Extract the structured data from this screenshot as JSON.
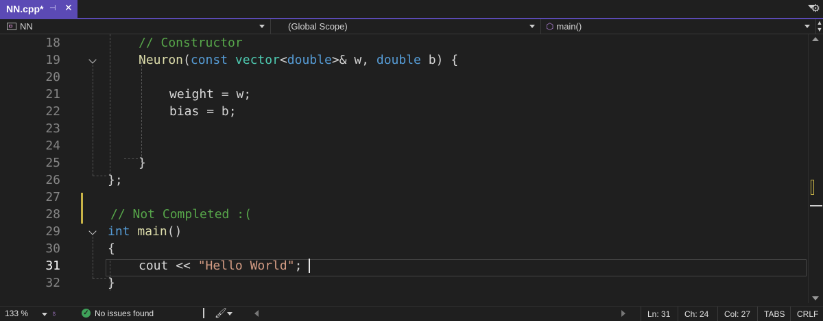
{
  "tab": {
    "title": "NN.cpp*",
    "pin_glyph": "⊣",
    "close_glyph": "✕"
  },
  "navbar": {
    "project": "NN",
    "scope": "(Global Scope)",
    "member": "main()"
  },
  "editor": {
    "current_line": 31,
    "lines": [
      {
        "number": "18"
      },
      {
        "number": "19"
      },
      {
        "number": "20"
      },
      {
        "number": "21"
      },
      {
        "number": "22"
      },
      {
        "number": "23"
      },
      {
        "number": "24"
      },
      {
        "number": "25"
      },
      {
        "number": "26"
      },
      {
        "number": "27"
      },
      {
        "number": "28"
      },
      {
        "number": "29"
      },
      {
        "number": "30"
      },
      {
        "number": "31"
      },
      {
        "number": "32"
      }
    ],
    "code": {
      "l18_comment": "// Constructor",
      "l19_fn": "Neuron",
      "l19_p1": "(",
      "l19_const": "const",
      "l19_vector": "vector",
      "l19_lt": "<",
      "l19_double1": "double",
      "l19_gt": ">&",
      "l19_w": "w",
      "l19_comma": ",",
      "l19_double2": "double",
      "l19_b": "b",
      "l19_end": ") {",
      "l21_weight": "weight",
      "l21_eq": " = ",
      "l21_w": "w",
      "l21_semi": ";",
      "l22_bias": "bias",
      "l22_eq": " = ",
      "l22_b": "b",
      "l22_semi": ";",
      "l25_brace": "}",
      "l26_end": "};",
      "l28_comment": "// Not Completed :(",
      "l29_int": "int",
      "l29_main": "main",
      "l29_paren": "()",
      "l30_brace": "{",
      "l31_cout": "cout",
      "l31_op": " << ",
      "l31_str": "\"Hello World\"",
      "l31_semi": ";",
      "l32_brace": "}"
    }
  },
  "statusbar": {
    "zoom": "133 %",
    "issues": "No issues found",
    "ln": "Ln: 31",
    "ch": "Ch: 24",
    "col": "Col: 27",
    "indent": "TABS",
    "eol": "CRLF"
  },
  "colors": {
    "accent": "#5b4ab5",
    "keyword": "#569cd6",
    "type": "#4ec9b0",
    "function": "#dcdcaa",
    "comment": "#57a64a",
    "string": "#d69d85",
    "change_marker": "#c8b347",
    "ok": "#3fa35a"
  },
  "icons": [
    "pin-icon",
    "close-icon",
    "dropdown-arrow-icon",
    "gear-icon",
    "project-icon",
    "cube-icon",
    "split-icon",
    "fold-chevron-icon",
    "check-circle-icon",
    "brush-icon"
  ]
}
